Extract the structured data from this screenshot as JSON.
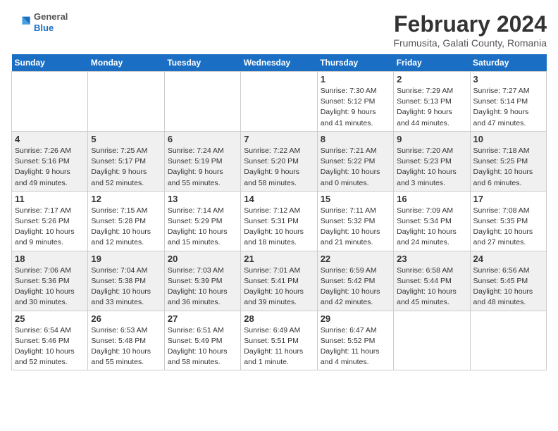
{
  "header": {
    "logo": {
      "general": "General",
      "blue": "Blue"
    },
    "title": "February 2024",
    "subtitle": "Frumusita, Galati County, Romania"
  },
  "days_of_week": [
    "Sunday",
    "Monday",
    "Tuesday",
    "Wednesday",
    "Thursday",
    "Friday",
    "Saturday"
  ],
  "weeks": [
    [
      {
        "day": "",
        "info": ""
      },
      {
        "day": "",
        "info": ""
      },
      {
        "day": "",
        "info": ""
      },
      {
        "day": "",
        "info": ""
      },
      {
        "day": "1",
        "info": "Sunrise: 7:30 AM\nSunset: 5:12 PM\nDaylight: 9 hours\nand 41 minutes."
      },
      {
        "day": "2",
        "info": "Sunrise: 7:29 AM\nSunset: 5:13 PM\nDaylight: 9 hours\nand 44 minutes."
      },
      {
        "day": "3",
        "info": "Sunrise: 7:27 AM\nSunset: 5:14 PM\nDaylight: 9 hours\nand 47 minutes."
      }
    ],
    [
      {
        "day": "4",
        "info": "Sunrise: 7:26 AM\nSunset: 5:16 PM\nDaylight: 9 hours\nand 49 minutes."
      },
      {
        "day": "5",
        "info": "Sunrise: 7:25 AM\nSunset: 5:17 PM\nDaylight: 9 hours\nand 52 minutes."
      },
      {
        "day": "6",
        "info": "Sunrise: 7:24 AM\nSunset: 5:19 PM\nDaylight: 9 hours\nand 55 minutes."
      },
      {
        "day": "7",
        "info": "Sunrise: 7:22 AM\nSunset: 5:20 PM\nDaylight: 9 hours\nand 58 minutes."
      },
      {
        "day": "8",
        "info": "Sunrise: 7:21 AM\nSunset: 5:22 PM\nDaylight: 10 hours\nand 0 minutes."
      },
      {
        "day": "9",
        "info": "Sunrise: 7:20 AM\nSunset: 5:23 PM\nDaylight: 10 hours\nand 3 minutes."
      },
      {
        "day": "10",
        "info": "Sunrise: 7:18 AM\nSunset: 5:25 PM\nDaylight: 10 hours\nand 6 minutes."
      }
    ],
    [
      {
        "day": "11",
        "info": "Sunrise: 7:17 AM\nSunset: 5:26 PM\nDaylight: 10 hours\nand 9 minutes."
      },
      {
        "day": "12",
        "info": "Sunrise: 7:15 AM\nSunset: 5:28 PM\nDaylight: 10 hours\nand 12 minutes."
      },
      {
        "day": "13",
        "info": "Sunrise: 7:14 AM\nSunset: 5:29 PM\nDaylight: 10 hours\nand 15 minutes."
      },
      {
        "day": "14",
        "info": "Sunrise: 7:12 AM\nSunset: 5:31 PM\nDaylight: 10 hours\nand 18 minutes."
      },
      {
        "day": "15",
        "info": "Sunrise: 7:11 AM\nSunset: 5:32 PM\nDaylight: 10 hours\nand 21 minutes."
      },
      {
        "day": "16",
        "info": "Sunrise: 7:09 AM\nSunset: 5:34 PM\nDaylight: 10 hours\nand 24 minutes."
      },
      {
        "day": "17",
        "info": "Sunrise: 7:08 AM\nSunset: 5:35 PM\nDaylight: 10 hours\nand 27 minutes."
      }
    ],
    [
      {
        "day": "18",
        "info": "Sunrise: 7:06 AM\nSunset: 5:36 PM\nDaylight: 10 hours\nand 30 minutes."
      },
      {
        "day": "19",
        "info": "Sunrise: 7:04 AM\nSunset: 5:38 PM\nDaylight: 10 hours\nand 33 minutes."
      },
      {
        "day": "20",
        "info": "Sunrise: 7:03 AM\nSunset: 5:39 PM\nDaylight: 10 hours\nand 36 minutes."
      },
      {
        "day": "21",
        "info": "Sunrise: 7:01 AM\nSunset: 5:41 PM\nDaylight: 10 hours\nand 39 minutes."
      },
      {
        "day": "22",
        "info": "Sunrise: 6:59 AM\nSunset: 5:42 PM\nDaylight: 10 hours\nand 42 minutes."
      },
      {
        "day": "23",
        "info": "Sunrise: 6:58 AM\nSunset: 5:44 PM\nDaylight: 10 hours\nand 45 minutes."
      },
      {
        "day": "24",
        "info": "Sunrise: 6:56 AM\nSunset: 5:45 PM\nDaylight: 10 hours\nand 48 minutes."
      }
    ],
    [
      {
        "day": "25",
        "info": "Sunrise: 6:54 AM\nSunset: 5:46 PM\nDaylight: 10 hours\nand 52 minutes."
      },
      {
        "day": "26",
        "info": "Sunrise: 6:53 AM\nSunset: 5:48 PM\nDaylight: 10 hours\nand 55 minutes."
      },
      {
        "day": "27",
        "info": "Sunrise: 6:51 AM\nSunset: 5:49 PM\nDaylight: 10 hours\nand 58 minutes."
      },
      {
        "day": "28",
        "info": "Sunrise: 6:49 AM\nSunset: 5:51 PM\nDaylight: 11 hours\nand 1 minute."
      },
      {
        "day": "29",
        "info": "Sunrise: 6:47 AM\nSunset: 5:52 PM\nDaylight: 11 hours\nand 4 minutes."
      },
      {
        "day": "",
        "info": ""
      },
      {
        "day": "",
        "info": ""
      }
    ]
  ]
}
